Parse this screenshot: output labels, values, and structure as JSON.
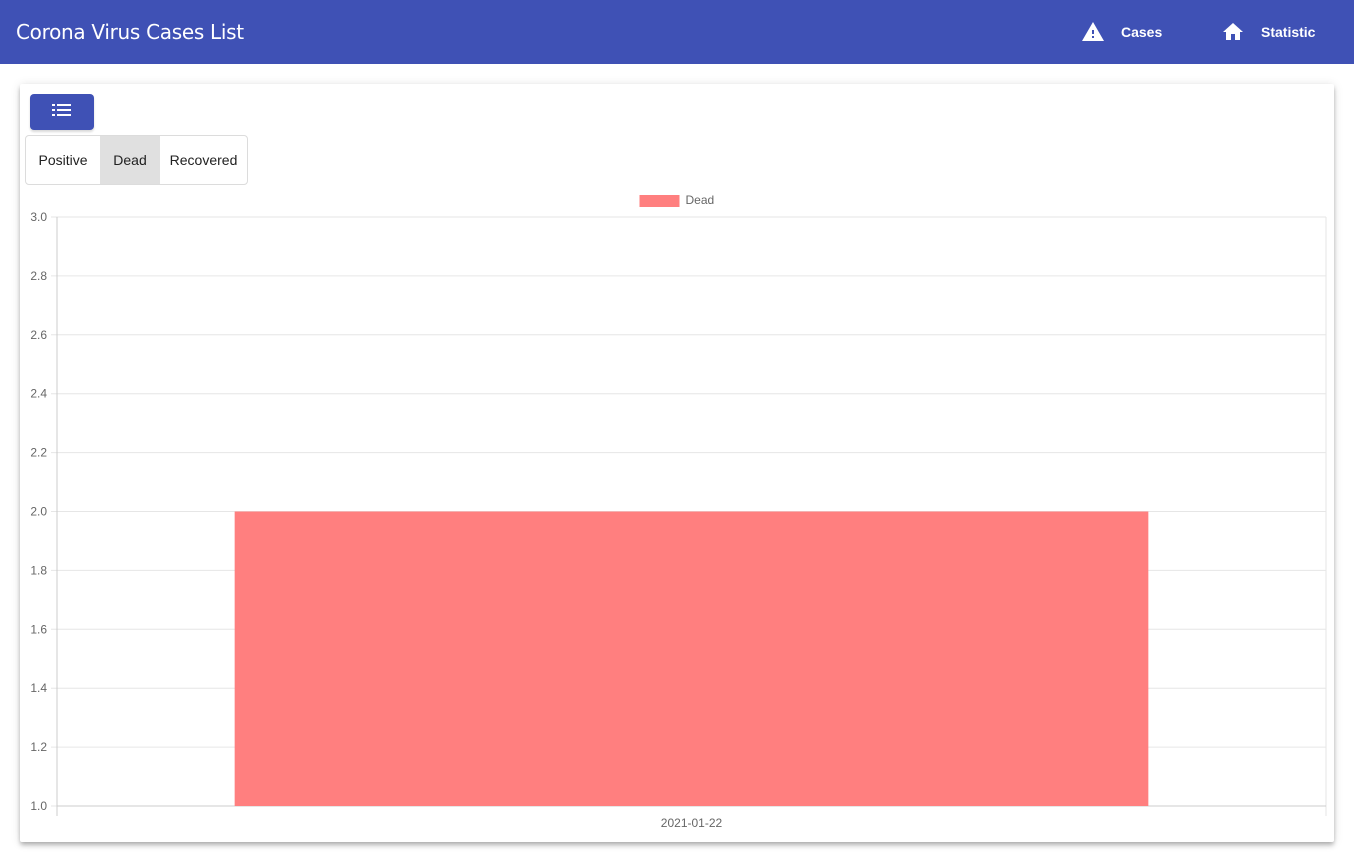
{
  "app": {
    "title": "Corona Virus Cases List"
  },
  "nav": {
    "items": [
      {
        "label": "Cases",
        "icon": "warning-icon"
      },
      {
        "label": "Statistic",
        "icon": "home-icon"
      }
    ]
  },
  "card": {
    "menu_icon": "list-icon",
    "toggles": [
      {
        "label": "Positive",
        "active": false
      },
      {
        "label": "Dead",
        "active": true
      },
      {
        "label": "Recovered",
        "active": false
      }
    ]
  },
  "colors": {
    "primary": "#3f51b5",
    "bar": "#ff7f7f"
  },
  "chart_data": {
    "type": "bar",
    "categories": [
      "2021-01-22"
    ],
    "series": [
      {
        "name": "Dead",
        "values": [
          2.0
        ]
      }
    ],
    "ylim": [
      1.0,
      3.0
    ],
    "yticks": [
      3.0,
      2.8,
      2.6,
      2.4,
      2.2,
      2.0,
      1.8,
      1.6,
      1.4,
      1.2,
      1.0
    ],
    "legend": "top-center",
    "grid": true
  }
}
